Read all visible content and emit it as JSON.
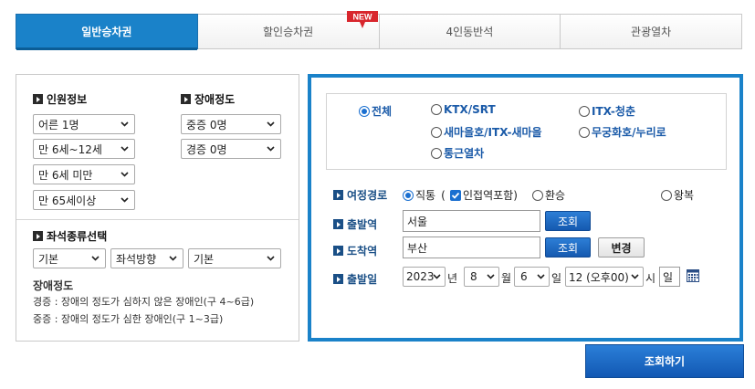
{
  "tabs": [
    {
      "label": "일반승차권",
      "active": true
    },
    {
      "label": "할인승차권",
      "badge": "NEW"
    },
    {
      "label": "4인동반석"
    },
    {
      "label": "관광열차"
    }
  ],
  "passenger": {
    "title": "인원정보",
    "adult": "어른 1명",
    "child": "만 6세~12세",
    "infant": "만 6세 미만",
    "senior": "만 65세이상"
  },
  "disability": {
    "title": "장애정도",
    "severe": "중증 0명",
    "mild": "경증 0명"
  },
  "seat": {
    "title": "좌석종류선택",
    "type": "기본",
    "direction": "좌석방향",
    "position": "기본"
  },
  "disability_note": {
    "heading": "장애정도",
    "mild": "경증 : 장애의 정도가 심하지 않은 장애인(구 4~6급)",
    "severe": "중증 : 장애의 정도가 심한 장애인(구 1~3급)"
  },
  "train_types": {
    "all": "전체",
    "ktx": "KTX/SRT",
    "itx_cheongchun": "ITX-청춘",
    "saemaul": "새마을호/ITX-새마을",
    "mugunghwa": "무궁화호/누리로",
    "commuter": "통근열차"
  },
  "route": {
    "label": "여정경로",
    "direct": "직통",
    "nearby_open": "(",
    "nearby": "인접역포함)",
    "transfer": "환승",
    "round_trip": "왕복"
  },
  "departure": {
    "label": "출발역",
    "value": "서울",
    "search": "조회"
  },
  "arrival": {
    "label": "도착역",
    "value": "부산",
    "search": "조회",
    "swap": "변경"
  },
  "date": {
    "label": "출발일",
    "year": "2023",
    "year_unit": "년",
    "month": "8",
    "month_unit": "월",
    "day": "6",
    "day_unit": "일",
    "hour": "12 (오후00)",
    "hour_unit": "시",
    "weekday": "일"
  },
  "search_button": "조회하기",
  "colors": {
    "accent": "#1a82c9",
    "label_blue": "#1a4f86",
    "new_badge": "#d8262d"
  },
  "icons": {
    "calendar": "calendar-icon",
    "dropdown": "chevron-down-icon"
  }
}
